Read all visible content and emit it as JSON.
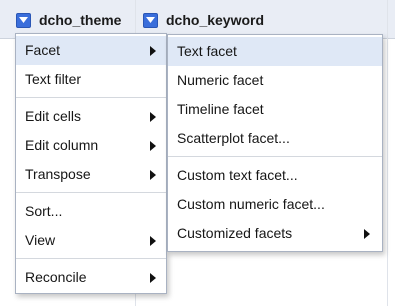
{
  "columns": [
    {
      "name": "dcho_theme"
    },
    {
      "name": "dcho_keyword"
    }
  ],
  "main_menu": {
    "items": [
      {
        "label": "Facet",
        "submenu": true
      },
      {
        "label": "Text filter",
        "submenu": false
      },
      {
        "label": "Edit cells",
        "submenu": true
      },
      {
        "label": "Edit column",
        "submenu": true
      },
      {
        "label": "Transpose",
        "submenu": true
      },
      {
        "label": "Sort...",
        "submenu": false
      },
      {
        "label": "View",
        "submenu": true
      },
      {
        "label": "Reconcile",
        "submenu": true
      }
    ]
  },
  "facet_menu": {
    "items": [
      {
        "label": "Text facet",
        "submenu": false
      },
      {
        "label": "Numeric facet",
        "submenu": false
      },
      {
        "label": "Timeline facet",
        "submenu": false
      },
      {
        "label": "Scatterplot facet...",
        "submenu": false
      },
      {
        "label": "Custom text facet...",
        "submenu": false
      },
      {
        "label": "Custom numeric facet...",
        "submenu": false
      },
      {
        "label": "Customized facets",
        "submenu": true
      }
    ]
  },
  "colors": {
    "accent": "#3a6edb",
    "header_bg": "#e9edf5",
    "highlight": "#dfe8f6"
  }
}
